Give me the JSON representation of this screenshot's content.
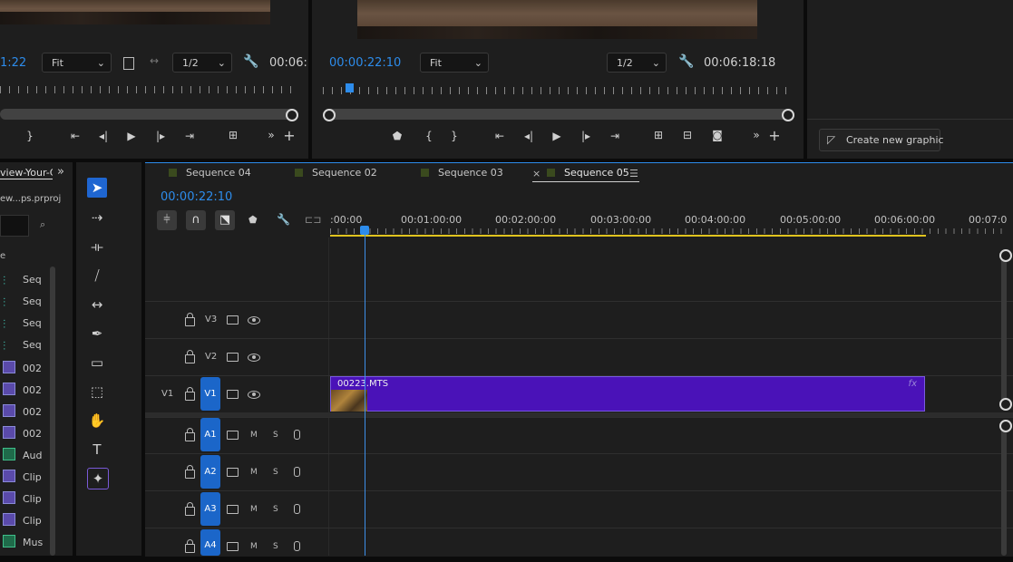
{
  "source_monitor": {
    "timecode": "1:22",
    "fit": "Fit",
    "resolution": "1/2",
    "duration": "00:06:"
  },
  "program_monitor": {
    "timecode": "00:00:22:10",
    "fit": "Fit",
    "resolution": "1/2",
    "duration": "00:06:18:18"
  },
  "essential_graphics": {
    "create_label": "Create new graphic"
  },
  "project": {
    "title": "view-Your-Cl",
    "file": "ew...ps.prproj",
    "col_header": "e",
    "items": [
      {
        "label": "Seq",
        "type": "seq"
      },
      {
        "label": "Seq",
        "type": "seq"
      },
      {
        "label": "Seq",
        "type": "seq"
      },
      {
        "label": "Seq",
        "type": "seq"
      },
      {
        "label": "002",
        "type": "clip"
      },
      {
        "label": "002",
        "type": "clip"
      },
      {
        "label": "002",
        "type": "clip"
      },
      {
        "label": "002",
        "type": "clip"
      },
      {
        "label": "Aud",
        "type": "aud"
      },
      {
        "label": "Clip",
        "type": "clip"
      },
      {
        "label": "Clip",
        "type": "clip"
      },
      {
        "label": "Clip",
        "type": "clip"
      },
      {
        "label": "Mus",
        "type": "aud"
      }
    ]
  },
  "timeline": {
    "tabs": [
      {
        "label": "Sequence 04"
      },
      {
        "label": "Sequence 02"
      },
      {
        "label": "Sequence 03"
      },
      {
        "label": "Sequence 05",
        "active": true
      }
    ],
    "close_glyph": "×",
    "menu_glyph": "☰",
    "timecode": "00:00:22:10",
    "ruler": [
      ":00:00",
      "00:01:00:00",
      "00:02:00:00",
      "00:03:00:00",
      "00:04:00:00",
      "00:05:00:00",
      "00:06:00:00",
      "00:07:0"
    ],
    "video_tracks": [
      "V3",
      "V2",
      "V1"
    ],
    "source_patch": "V1",
    "audio_tracks": [
      "A1",
      "A2",
      "A3",
      "A4"
    ],
    "mute": "M",
    "solo": "S",
    "clip": {
      "name": "00223.MTS",
      "fx": "fx",
      "color": "#4a12b8"
    }
  },
  "colors": {
    "accent_blue": "#2d8ceb",
    "track_blue": "#1b66c9",
    "work_area_yellow": "#e0c31e"
  }
}
